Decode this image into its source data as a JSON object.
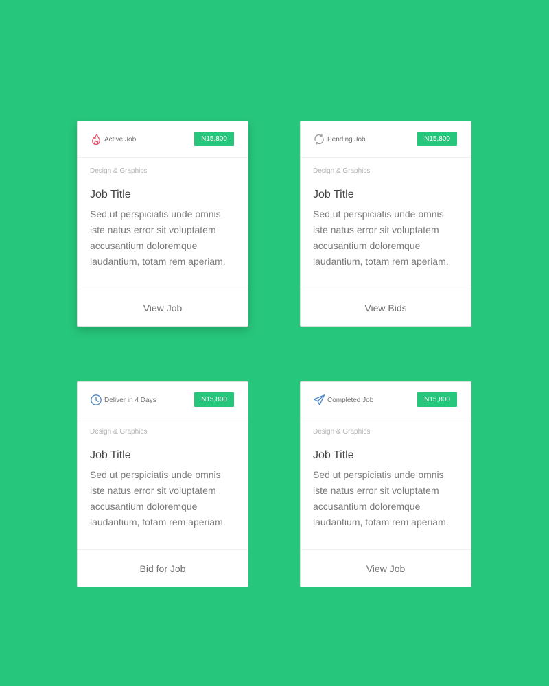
{
  "colors": {
    "background": "#26c77c",
    "badge": "#26c77c",
    "card": "#ffffff",
    "fire_icon": "#e8566e",
    "refresh_icon": "#9a9a9a",
    "clock_icon": "#4d86c6",
    "plane_icon": "#4d86c6"
  },
  "cards": [
    {
      "status_icon": "fire-icon",
      "status": "Active Job",
      "price": "N15,800",
      "category": "Design & Graphics",
      "title": "Job Title",
      "description": "Sed ut perspiciatis unde omnis iste natus error sit voluptatem accusantium doloremque laudantium, totam rem aperiam.",
      "action": "View Job"
    },
    {
      "status_icon": "refresh-icon",
      "status": "Pending Job",
      "price": "N15,800",
      "category": "Design & Graphics",
      "title": "Job Title",
      "description": "Sed ut perspiciatis unde omnis iste natus error sit voluptatem accusantium doloremque laudantium, totam rem aperiam.",
      "action": "View Bids"
    },
    {
      "status_icon": "clock-icon",
      "status": "Deliver in 4 Days",
      "price": "N15,800",
      "category": "Design & Graphics",
      "title": "Job Title",
      "description": "Sed ut perspiciatis unde omnis iste natus error sit voluptatem accusantium doloremque laudantium, totam rem aperiam.",
      "action": "Bid for Job"
    },
    {
      "status_icon": "paper-plane-icon",
      "status": "Completed Job",
      "price": "N15,800",
      "category": "Design & Graphics",
      "title": "Job Title",
      "description": "Sed ut perspiciatis unde omnis iste natus error sit voluptatem accusantium doloremque laudantium, totam rem aperiam.",
      "action": "View Job"
    }
  ]
}
